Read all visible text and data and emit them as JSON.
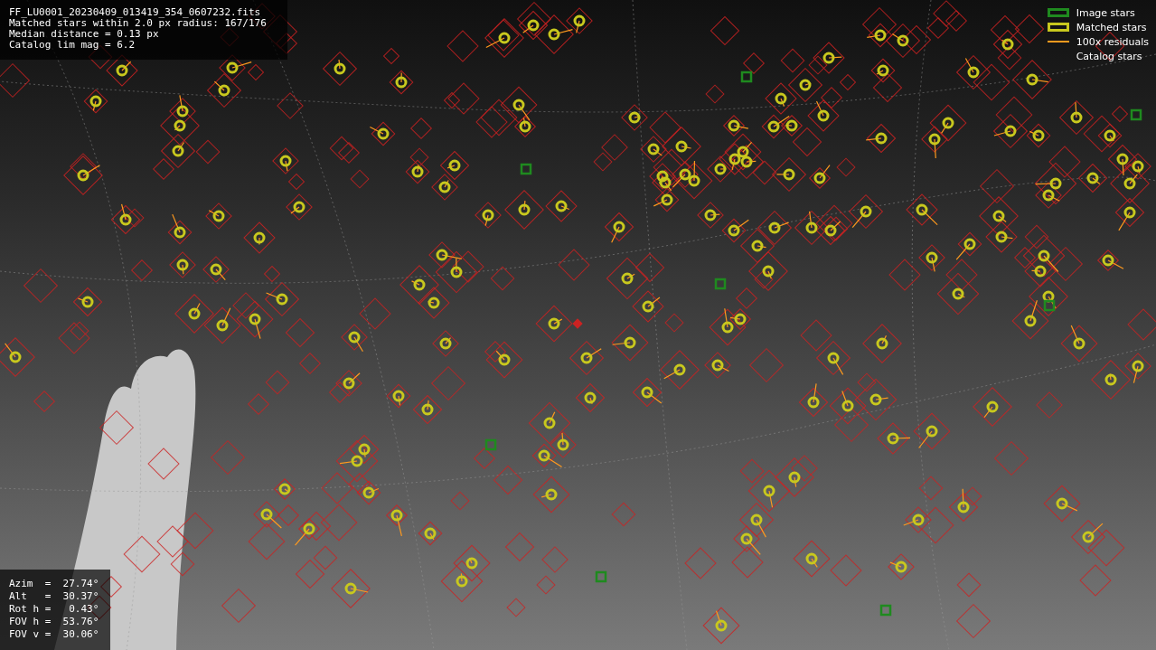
{
  "info_box": {
    "lines": [
      "FF_LU0001_20230409_013419_354_0607232.fits",
      "Matched stars within 2.0 px radius: 167/176",
      "Median distance = 0.13 px",
      "Catalog lim mag = 6.2"
    ]
  },
  "pointing_box": {
    "lines": [
      "Azim  =  27.74°",
      "Alt   =  30.37°",
      "Rot h =   0.43°",
      "FOV h =  53.76°",
      "FOV v =  30.06°"
    ]
  },
  "legend": {
    "items": [
      {
        "kind": "image",
        "label": "Image stars",
        "color": "#1f8a1f"
      },
      {
        "kind": "matched",
        "label": "Matched stars",
        "color": "#c8c81e"
      },
      {
        "kind": "residual",
        "label": "100x residuals",
        "color": "#ff9a1e"
      },
      {
        "kind": "catalog",
        "label": "Catalog stars"
      }
    ]
  }
}
